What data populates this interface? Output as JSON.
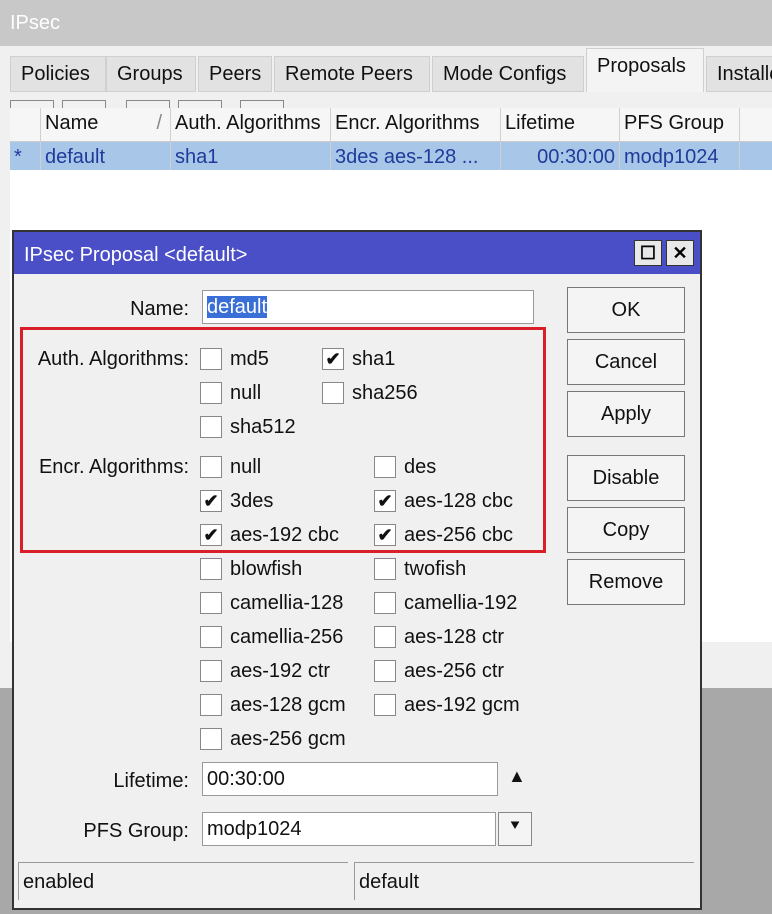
{
  "window_title": "IPsec",
  "tabs": [
    "Policies",
    "Groups",
    "Peers",
    "Remote Peers",
    "Mode Configs",
    "Proposals",
    "Installe"
  ],
  "active_tab": "Proposals",
  "toolbar": {
    "add": "add-icon",
    "remove": "remove-icon",
    "enable": "check-icon",
    "disable": "x-icon",
    "filter": "filter-icon"
  },
  "list": {
    "headers": [
      "Name",
      "Auth. Algorithms",
      "Encr. Algorithms",
      "Lifetime",
      "PFS Group"
    ],
    "sort_marker": "/",
    "rows": [
      {
        "flag": "*",
        "name": "default",
        "auth": "sha1",
        "encr": "3des aes-128 ...",
        "lifetime": "00:30:00",
        "pfs": "modp1024"
      }
    ]
  },
  "dialog": {
    "title": "IPsec Proposal <default>",
    "name_label": "Name:",
    "name_value": "default",
    "auth_label": "Auth. Algorithms:",
    "auth": [
      {
        "label": "md5",
        "checked": false
      },
      {
        "label": "sha1",
        "checked": true
      },
      {
        "label": "null",
        "checked": false
      },
      {
        "label": "sha256",
        "checked": false
      },
      {
        "label": "sha512",
        "checked": false
      }
    ],
    "encr_label": "Encr. Algorithms:",
    "encr": [
      {
        "label": "null",
        "checked": false
      },
      {
        "label": "des",
        "checked": false
      },
      {
        "label": "3des",
        "checked": true
      },
      {
        "label": "aes-128 cbc",
        "checked": true
      },
      {
        "label": "aes-192 cbc",
        "checked": true
      },
      {
        "label": "aes-256 cbc",
        "checked": true
      },
      {
        "label": "blowfish",
        "checked": false
      },
      {
        "label": "twofish",
        "checked": false
      },
      {
        "label": "camellia-128",
        "checked": false
      },
      {
        "label": "camellia-192",
        "checked": false
      },
      {
        "label": "camellia-256",
        "checked": false
      },
      {
        "label": "aes-128 ctr",
        "checked": false
      },
      {
        "label": "aes-192 ctr",
        "checked": false
      },
      {
        "label": "aes-256 ctr",
        "checked": false
      },
      {
        "label": "aes-128 gcm",
        "checked": false
      },
      {
        "label": "aes-192 gcm",
        "checked": false
      },
      {
        "label": "aes-256 gcm",
        "checked": false
      }
    ],
    "lifetime_label": "Lifetime:",
    "lifetime_value": "00:30:00",
    "pfs_label": "PFS Group:",
    "pfs_value": "modp1024",
    "buttons": [
      "OK",
      "Cancel",
      "Apply",
      "Disable",
      "Copy",
      "Remove"
    ],
    "status": [
      "enabled",
      "default"
    ],
    "highlight_color": "#d81f2a"
  }
}
